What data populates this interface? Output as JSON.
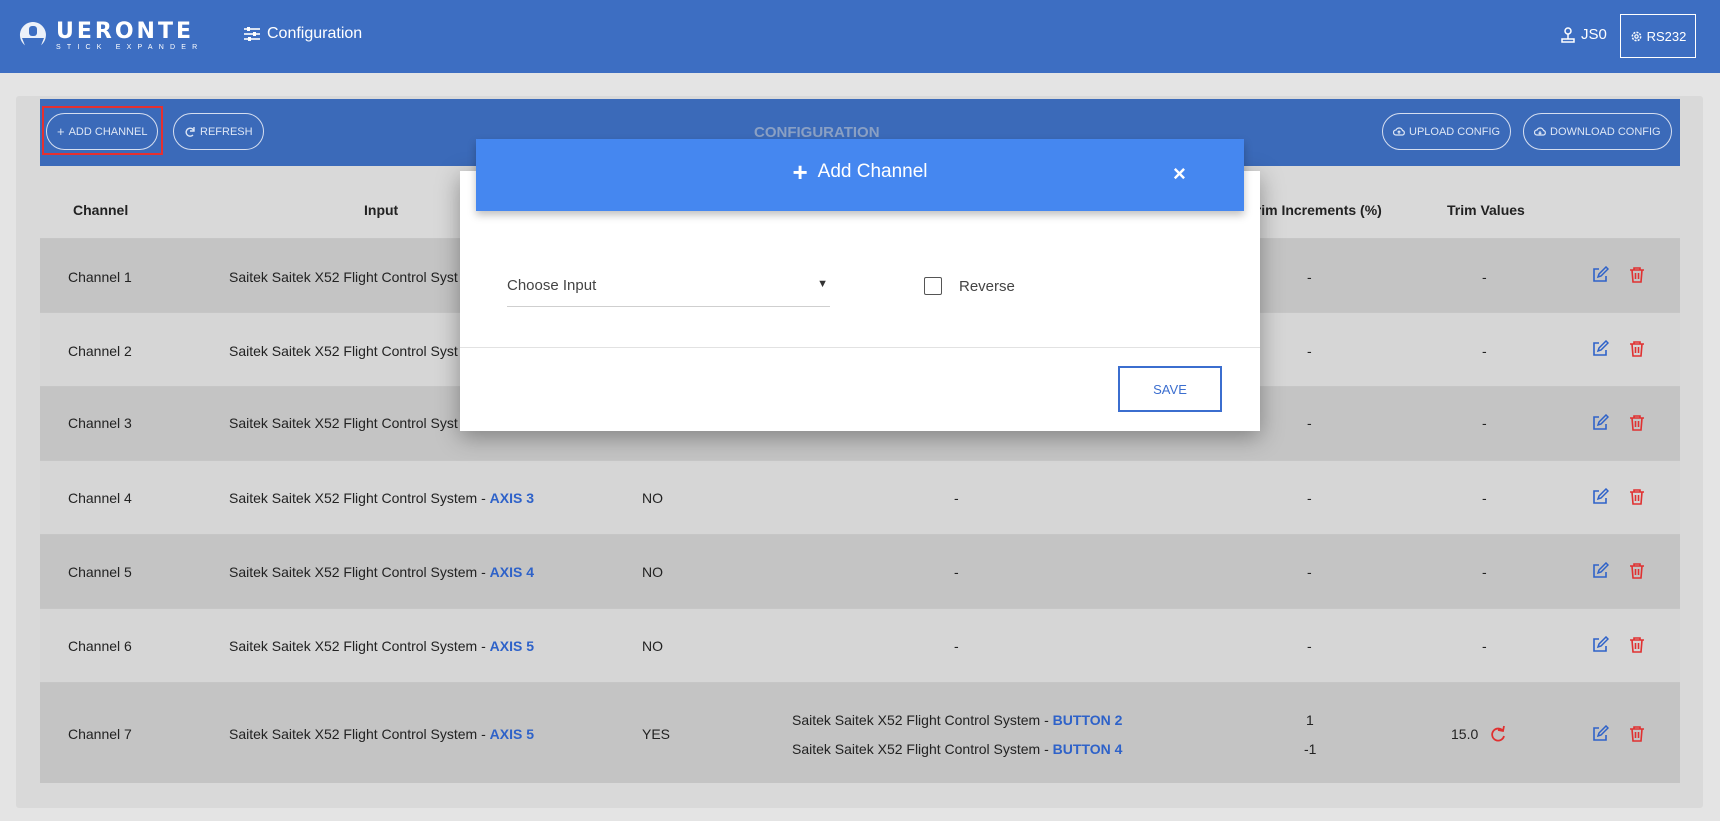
{
  "app": {
    "logo_title": "UERONTE",
    "logo_subtitle": "STICK EXPANDER",
    "nav_config_label": "Configuration",
    "user_label": "JS0",
    "port_label": "RS232"
  },
  "toolbar": {
    "add_channel": "ADD CHANNEL",
    "refresh": "REFRESH",
    "title": "CONFIGURATION",
    "upload": "UPLOAD CONFIG",
    "download": "DOWNLOAD CONFIG"
  },
  "table": {
    "headers": {
      "channel": "Channel",
      "input": "Input",
      "trim_increments": "Trim Increments (%)",
      "trim_values": "Trim Values"
    },
    "rows": [
      {
        "channel": "Channel 1",
        "input_prefix": "Saitek Saitek X52 Flight Control Syst",
        "input_axis": "",
        "reverse": "",
        "trim_inputs": "",
        "trim_increments": "-",
        "trim_values": "-"
      },
      {
        "channel": "Channel 2",
        "input_prefix": "Saitek Saitek X52 Flight Control Syst",
        "input_axis": "",
        "reverse": "",
        "trim_inputs": "",
        "trim_increments": "-",
        "trim_values": "-"
      },
      {
        "channel": "Channel 3",
        "input_prefix": "Saitek Saitek X52 Flight Control Syst",
        "input_axis": "",
        "reverse": "",
        "trim_inputs": "",
        "trim_increments": "-",
        "trim_values": "-"
      },
      {
        "channel": "Channel 4",
        "input_prefix": "Saitek Saitek X52 Flight Control System - ",
        "input_axis": "AXIS 3",
        "reverse": "NO",
        "trim_inputs": "-",
        "trim_increments": "-",
        "trim_values": "-"
      },
      {
        "channel": "Channel 5",
        "input_prefix": "Saitek Saitek X52 Flight Control System - ",
        "input_axis": "AXIS 4",
        "reverse": "NO",
        "trim_inputs": "-",
        "trim_increments": "-",
        "trim_values": "-"
      },
      {
        "channel": "Channel 6",
        "input_prefix": "Saitek Saitek X52 Flight Control System - ",
        "input_axis": "AXIS 5",
        "reverse": "NO",
        "trim_inputs": "-",
        "trim_increments": "-",
        "trim_values": "-"
      },
      {
        "channel": "Channel 7",
        "input_prefix": "Saitek Saitek X52 Flight Control System - ",
        "input_axis": "AXIS 5",
        "reverse": "YES",
        "trim_input_1_prefix": "Saitek Saitek X52 Flight Control System - ",
        "trim_input_1_button": "BUTTON 2",
        "trim_input_2_prefix": "Saitek Saitek X52 Flight Control System - ",
        "trim_input_2_button": "BUTTON 4",
        "trim_increment_1": "1",
        "trim_increment_2": "-1",
        "trim_values": "15.0"
      }
    ]
  },
  "modal": {
    "title": "Add Channel",
    "close": "×",
    "select_value": "Choose Input",
    "reverse_label": "Reverse",
    "reverse_checked": false,
    "save_label": "SAVE"
  },
  "colors": {
    "navbar": "#3d6ec2",
    "toolbar": "#3b6ab9",
    "modal_header": "#4587f0",
    "accent_blue": "#2e62c9",
    "delete_red": "#e03030",
    "highlight_red": "#e53030"
  }
}
